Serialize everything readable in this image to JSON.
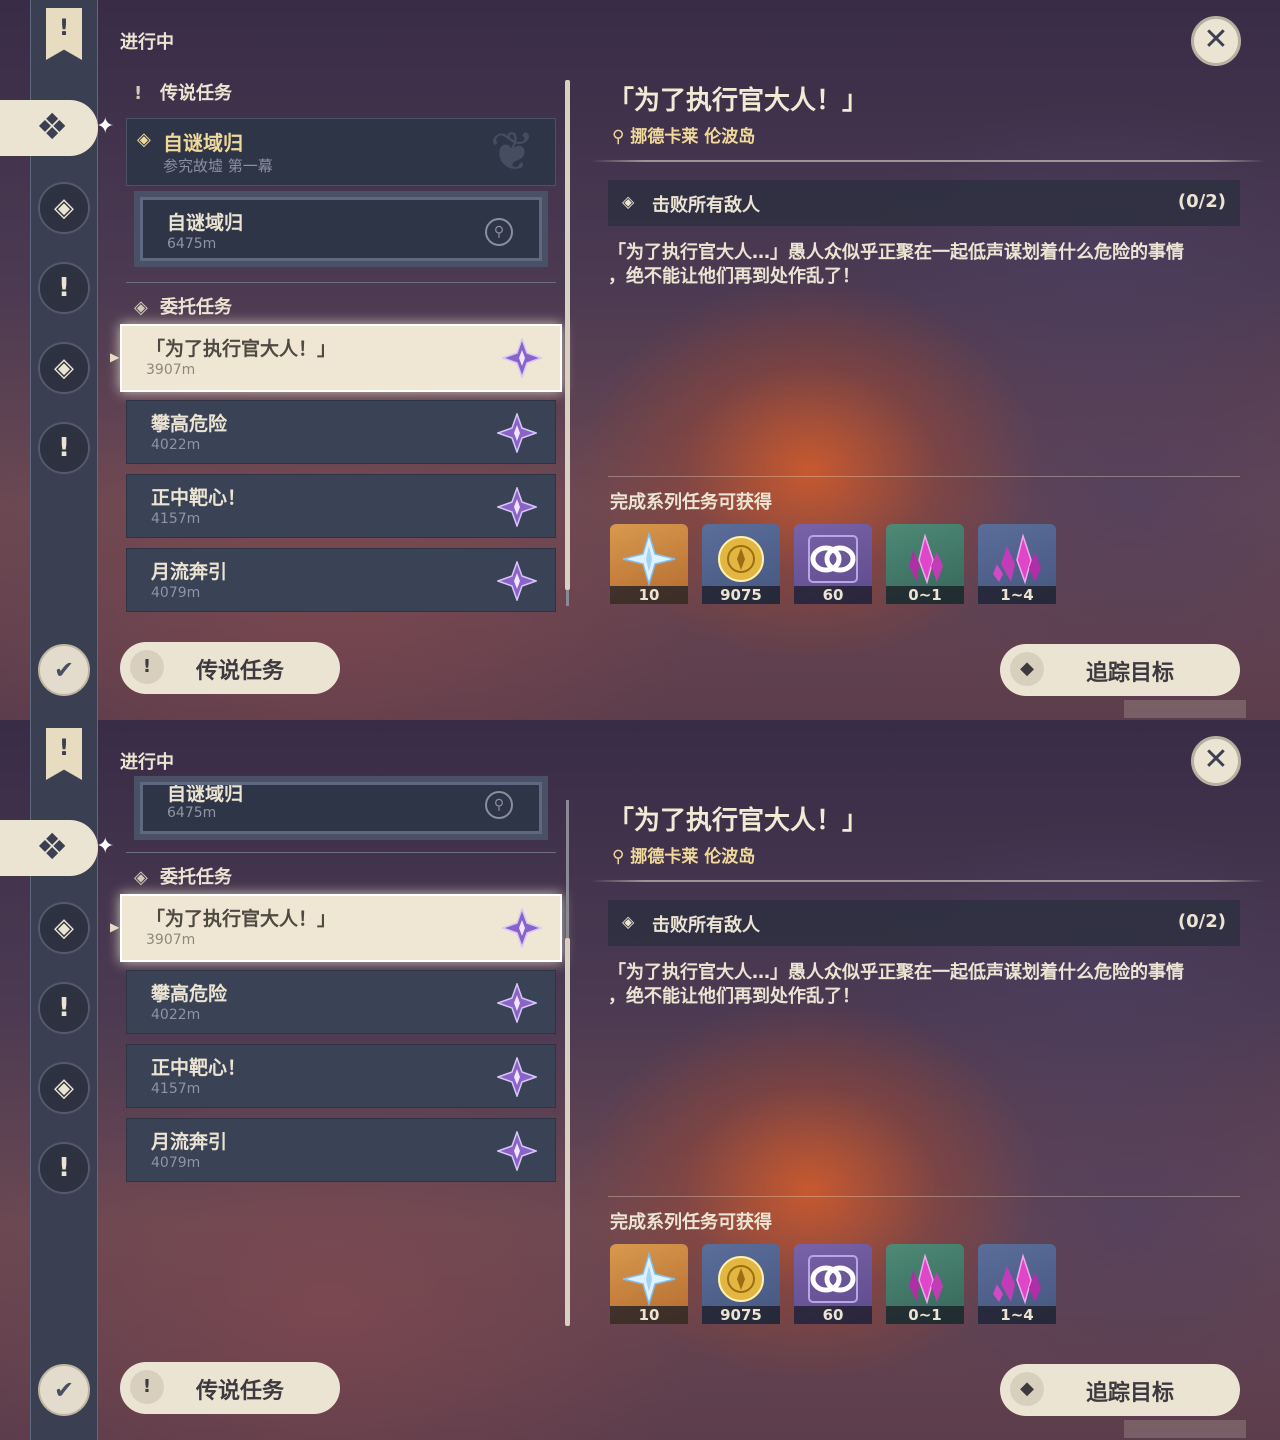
{
  "screens": [
    {
      "section_label": "进行中",
      "archon_header": "传说任务",
      "chapter": {
        "title": "自谜域归",
        "subtitle": "参究故墟 第一幕"
      },
      "archon_item": {
        "name": "自谜域归",
        "distance": "6475m"
      },
      "commission_header": "委托任务",
      "commissions": [
        {
          "name": "「为了执行官大人！」",
          "distance": "3907m",
          "selected": true
        },
        {
          "name": "攀高危险",
          "distance": "4022m"
        },
        {
          "name": "正中靶心！",
          "distance": "4157m"
        },
        {
          "name": "月流奔引",
          "distance": "4079m"
        }
      ],
      "bottom_button": "传说任务",
      "quest_title": "「为了执行官大人！」",
      "location": "挪德卡莱 伦波岛",
      "objective": {
        "text": "击败所有敌人",
        "progress": "(0/2)"
      },
      "description_line1": "「为了执行官大人…」愚人众似乎正聚在一起低声谋划着什么危险的事情",
      "description_line2": "，绝不能让他们再到处作乱了！",
      "rewards_header": "完成系列任务可获得",
      "rewards": [
        {
          "icon": "primogem-icon",
          "count": "10"
        },
        {
          "icon": "mora-icon",
          "count": "9075"
        },
        {
          "icon": "adventure-exp-icon",
          "count": "60"
        },
        {
          "icon": "crystal-chunk-icon",
          "count": "0~1"
        },
        {
          "icon": "crystal-cluster-icon",
          "count": "1~4"
        }
      ],
      "track_button": "追踪目标"
    },
    {
      "section_label": "进行中",
      "archon_item": {
        "name": "自谜域归",
        "distance": "6475m"
      },
      "commission_header": "委托任务",
      "commissions": [
        {
          "name": "「为了执行官大人！」",
          "distance": "3907m",
          "selected": true
        },
        {
          "name": "攀高危险",
          "distance": "4022m"
        },
        {
          "name": "正中靶心！",
          "distance": "4157m"
        },
        {
          "name": "月流奔引",
          "distance": "4079m"
        }
      ],
      "bottom_button": "传说任务",
      "quest_title": "「为了执行官大人！」",
      "location": "挪德卡莱 伦波岛",
      "objective": {
        "text": "击败所有敌人",
        "progress": "(0/2)"
      },
      "description_line1": "「为了执行官大人…」愚人众似乎正聚在一起低声谋划着什么危险的事情",
      "description_line2": "，绝不能让他们再到处作乱了！",
      "rewards_header": "完成系列任务可获得",
      "rewards": [
        {
          "icon": "primogem-icon",
          "count": "10"
        },
        {
          "icon": "mora-icon",
          "count": "9075"
        },
        {
          "icon": "adventure-exp-icon",
          "count": "60"
        },
        {
          "icon": "crystal-chunk-icon",
          "count": "0~1"
        },
        {
          "icon": "crystal-cluster-icon",
          "count": "1~4"
        }
      ],
      "track_button": "追踪目标"
    }
  ],
  "icons": {
    "bookmark": "!",
    "selected_tab": "❖",
    "rail_1": "◈",
    "rail_2": "!",
    "rail_3": "◈",
    "rail_4": "!",
    "rail_5": "✔",
    "close": "✕",
    "pin": "⚲",
    "diamond": "◈",
    "exclaim": "!",
    "track": "◆",
    "location": "⚲",
    "arrow": "▶"
  },
  "colors": {
    "accent_gold": "#f0d89a",
    "cream": "#ece4d2",
    "commission_star": "#8a62c8"
  }
}
